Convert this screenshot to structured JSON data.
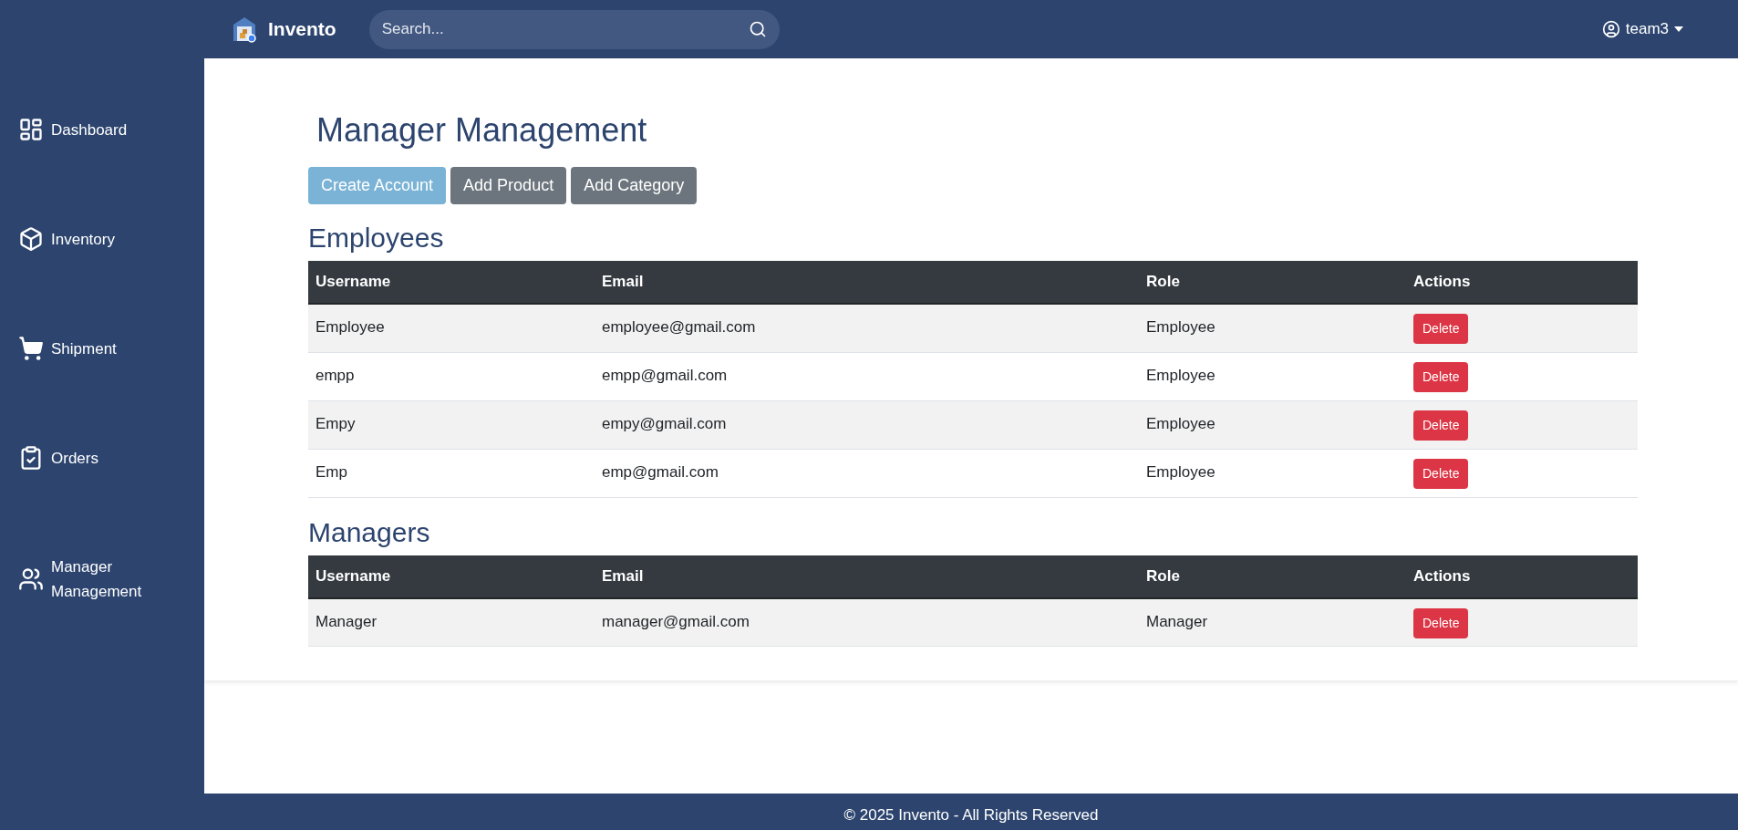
{
  "brand": "Invento",
  "search": {
    "placeholder": "Search..."
  },
  "user": {
    "name": "team3"
  },
  "sidebar": {
    "items": [
      {
        "label": "Dashboard",
        "kind": "dashboard"
      },
      {
        "label": "Inventory",
        "kind": "box"
      },
      {
        "label": "Shipment",
        "kind": "cart"
      },
      {
        "label": "Orders",
        "kind": "clipboard"
      },
      {
        "label": "Manager Management",
        "kind": "users"
      }
    ]
  },
  "title": "Manager Management",
  "actions": [
    {
      "label": "Create Account",
      "kind": "info"
    },
    {
      "label": "Add Product",
      "kind": "secondary"
    },
    {
      "label": "Add Category",
      "kind": "secondary"
    }
  ],
  "sections": [
    {
      "heading": "Employees",
      "columns": [
        "Username",
        "Email",
        "Role",
        "Actions"
      ],
      "rows": [
        {
          "cells": [
            "Employee",
            "employee@gmail.com",
            "Employee"
          ],
          "action": "Delete"
        },
        {
          "cells": [
            "empp",
            "empp@gmail.com",
            "Employee"
          ],
          "action": "Delete"
        },
        {
          "cells": [
            "Empy",
            "empy@gmail.com",
            "Employee"
          ],
          "action": "Delete"
        },
        {
          "cells": [
            "Emp",
            "emp@gmail.com",
            "Employee"
          ],
          "action": "Delete"
        }
      ]
    },
    {
      "heading": "Managers",
      "columns": [
        "Username",
        "Email",
        "Role",
        "Actions"
      ],
      "rows": [
        {
          "cells": [
            "Manager",
            "manager@gmail.com",
            "Manager"
          ],
          "action": "Delete"
        }
      ]
    }
  ],
  "footer": "© 2025 Invento - All Rights Reserved"
}
